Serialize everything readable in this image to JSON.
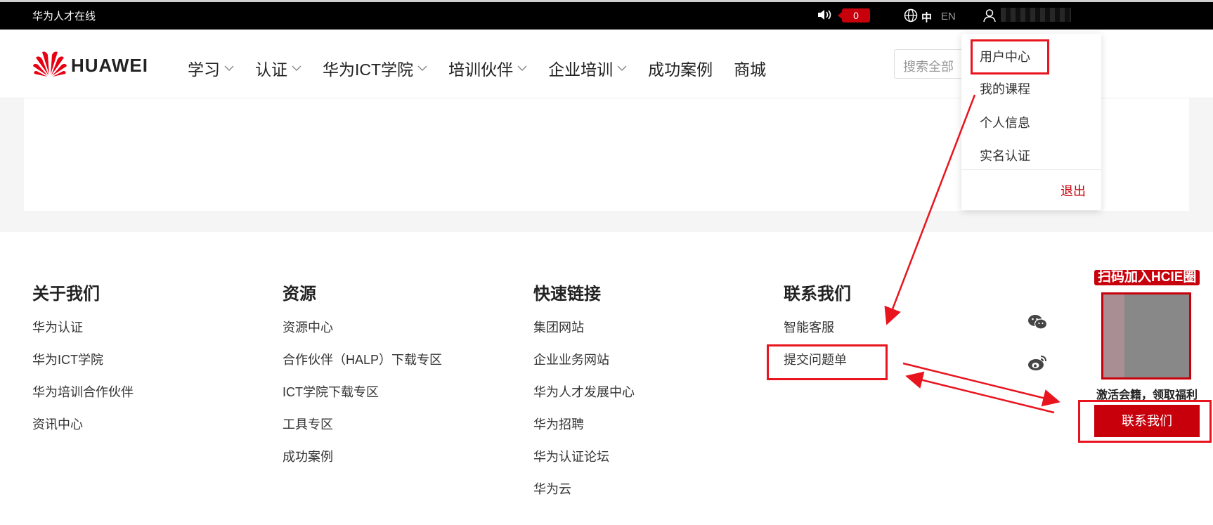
{
  "topbar": {
    "site_name": "华为人才在线",
    "notification_count": "0",
    "lang_zh": "中",
    "lang_en": "EN"
  },
  "header": {
    "logo_text": "HUAWEI",
    "nav": [
      {
        "label": "学习",
        "has_dropdown": true
      },
      {
        "label": "认证",
        "has_dropdown": true
      },
      {
        "label": "华为ICT学院",
        "has_dropdown": true
      },
      {
        "label": "培训伙伴",
        "has_dropdown": true
      },
      {
        "label": "企业培训",
        "has_dropdown": true
      },
      {
        "label": "成功案例",
        "has_dropdown": false
      },
      {
        "label": "商城",
        "has_dropdown": false
      }
    ],
    "search_placeholder": "搜索全部"
  },
  "user_menu": {
    "items": [
      "用户中心",
      "我的课程",
      "个人信息",
      "实名认证"
    ],
    "logout": "退出"
  },
  "footer": {
    "columns": [
      {
        "title": "关于我们",
        "links": [
          "华为认证",
          "华为ICT学院",
          "华为培训合作伙伴",
          "资讯中心"
        ]
      },
      {
        "title": "资源",
        "links": [
          "资源中心",
          "合作伙伴（HALP）下载专区",
          "ICT学院下载专区",
          "工具专区",
          "成功案例"
        ]
      },
      {
        "title": "快速链接",
        "links": [
          "集团网站",
          "企业业务网站",
          "华为人才发展中心",
          "华为招聘",
          "华为认证论坛",
          "华为云"
        ]
      },
      {
        "title": "联系我们",
        "links": [
          "智能客服",
          "提交问题单"
        ]
      }
    ],
    "qr_title": "扫码加入HCIE圈",
    "qr_caption": "激活会籍，领取福利",
    "contact_button": "联系我们"
  },
  "colors": {
    "brand_red": "#c7000b",
    "annotation_red": "#e8141e"
  }
}
